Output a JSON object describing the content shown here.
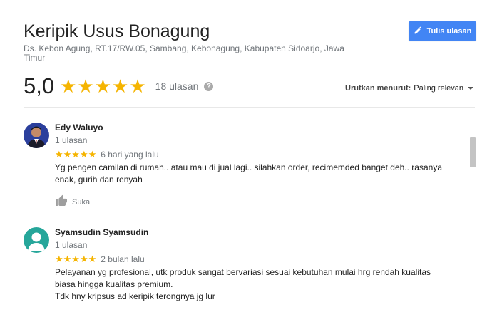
{
  "place": {
    "name": "Keripik Usus Bonagung",
    "address": "Ds. Kebon Agung, RT.17/RW.05, Sambang, Kebonagung, Kabupaten Sidoarjo, Jawa Timur"
  },
  "write_review": {
    "label": "Tulis ulasan",
    "icon": "pencil-icon"
  },
  "summary": {
    "rating": "5,0",
    "stars": "★★★★★",
    "count": "18 ulasan",
    "help": "?"
  },
  "sort": {
    "label": "Urutkan menurut:",
    "value": "Paling relevan"
  },
  "reviews": [
    {
      "name": "Edy Waluyo",
      "sub": "1 ulasan",
      "stars": "★★★★★",
      "time": "6 hari yang lalu",
      "text": [
        "Yg pengen camilan di rumah.. atau mau di jual lagi.. silahkan order, recimemded banget deh.. rasanya enak, gurih dan renyah"
      ],
      "like": "Suka"
    },
    {
      "name": "Syamsudin Syamsudin",
      "sub": "1 ulasan",
      "stars": "★★★★★",
      "time": "2 bulan lalu",
      "text": [
        "Pelayanan yg profesional, utk produk sangat bervariasi sesuai kebutuhan mulai hrg rendah kualitas biasa hingga kualitas premium.",
        "Tdk hny kripsus ad keripik terongnya jg lur"
      ]
    }
  ],
  "colors": {
    "accent": "#4285f4",
    "star": "#f5b400",
    "avatar2": "#26a69a"
  }
}
